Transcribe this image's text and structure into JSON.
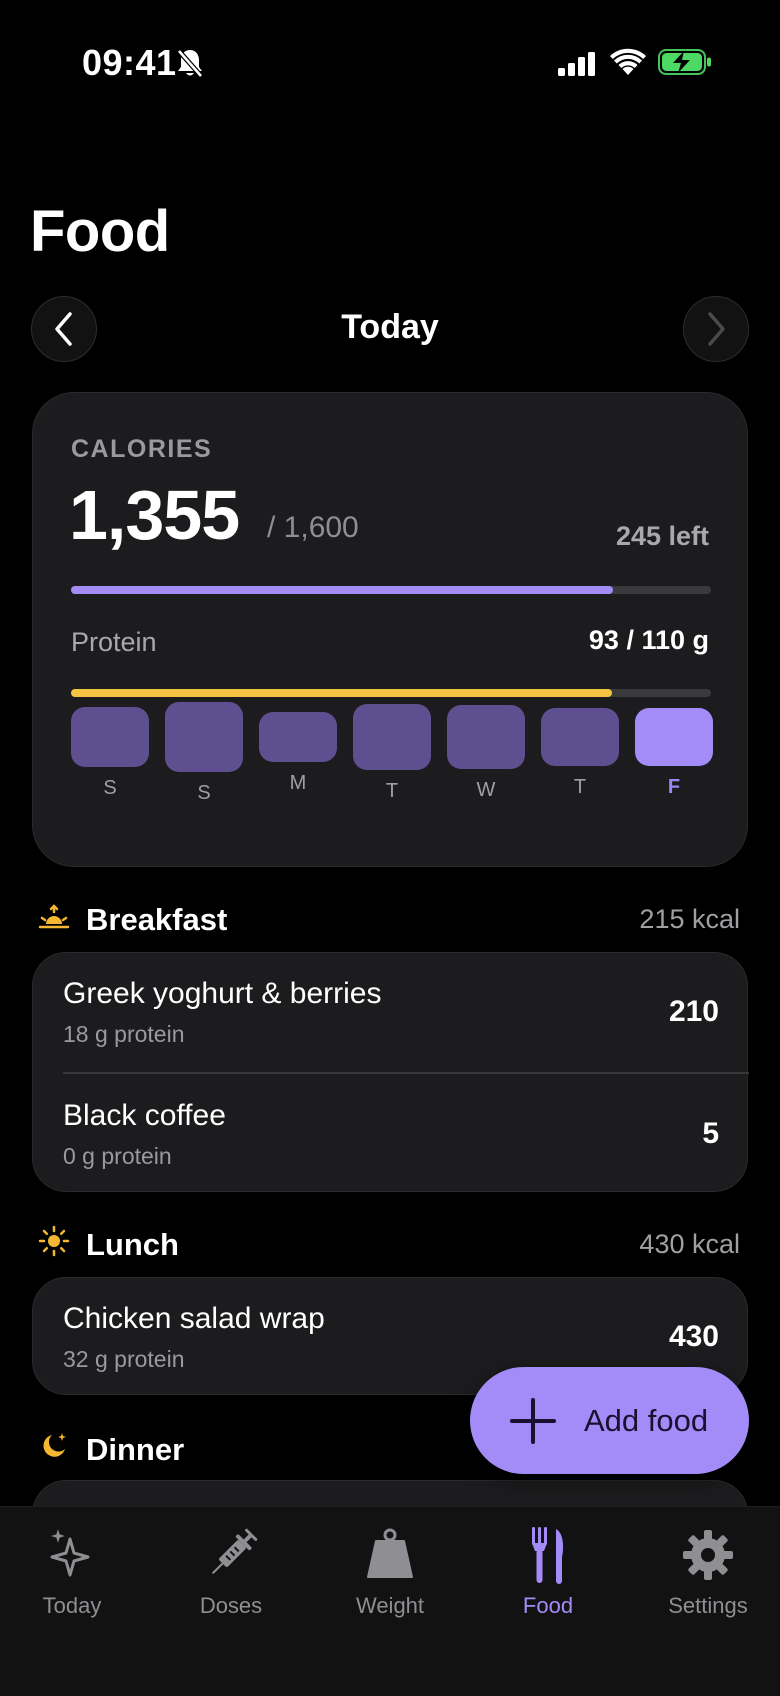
{
  "status_bar": {
    "time": "09:41",
    "icons": [
      "bell-slash-icon",
      "signal-icon",
      "wifi-icon",
      "battery-charging-icon"
    ]
  },
  "page": {
    "title": "Food"
  },
  "date_nav": {
    "label": "Today",
    "prev_icon": "chevron-left-icon",
    "next_icon": "chevron-right-icon"
  },
  "calories": {
    "label": "CALORIES",
    "value": "1,355",
    "goal": "/ 1,600",
    "left": "245 left",
    "progress": 0.847,
    "color": "#a48cf8"
  },
  "protein": {
    "label": "Protein",
    "value": "93 / 110 g",
    "progress": 0.845,
    "color": "#f5c242"
  },
  "week": [
    {
      "label": "S",
      "level": 0.6
    },
    {
      "label": "S",
      "level": 0.7
    },
    {
      "label": "M",
      "level": 0.5
    },
    {
      "label": "T",
      "level": 0.66
    },
    {
      "label": "W",
      "level": 0.64
    },
    {
      "label": "T",
      "level": 0.58
    },
    {
      "label": "F",
      "level": 0.58,
      "active": true
    }
  ],
  "meals": [
    {
      "name": "Breakfast",
      "icon": "sunrise-icon",
      "kcal": "215 kcal",
      "items": [
        {
          "name": "Greek yoghurt & berries",
          "protein": "18 g protein",
          "kcal": "210"
        },
        {
          "name": "Black coffee",
          "protein": "0 g protein",
          "kcal": "5"
        }
      ]
    },
    {
      "name": "Lunch",
      "icon": "sun-icon",
      "kcal": "430 kcal",
      "items": [
        {
          "name": "Chicken salad wrap",
          "protein": "32 g protein",
          "kcal": "430"
        }
      ]
    },
    {
      "name": "Dinner",
      "icon": "moon-stars-icon"
    }
  ],
  "fab": {
    "label": "Add food",
    "icon": "plus-icon"
  },
  "tabs": [
    {
      "label": "Today",
      "icon": "sparkles-icon"
    },
    {
      "label": "Doses",
      "icon": "syringe-icon"
    },
    {
      "label": "Weight",
      "icon": "scale-icon"
    },
    {
      "label": "Food",
      "icon": "fork-knife-icon",
      "active": true
    },
    {
      "label": "Settings",
      "icon": "gear-icon"
    }
  ]
}
